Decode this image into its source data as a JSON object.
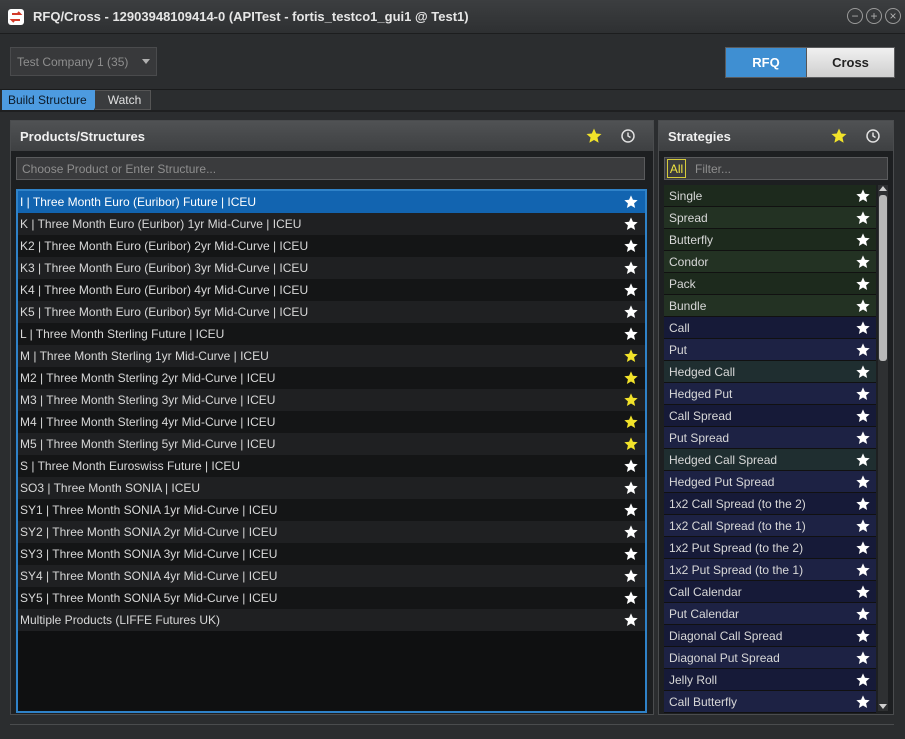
{
  "window": {
    "title": "RFQ/Cross - 12903948109414-0 (APITest - fortis_testco1_gui1 @ Test1)",
    "app_icon": "rfq-app-icon",
    "controls": [
      "minimize-icon",
      "maximize-icon",
      "close-icon"
    ]
  },
  "toolbar": {
    "company_selected": "Test Company 1 (35)",
    "rfq_label": "RFQ",
    "cross_label": "Cross",
    "active_mode": "RFQ"
  },
  "tabs": [
    {
      "label": "Build Structure",
      "active": true
    },
    {
      "label": "Watch",
      "active": false
    }
  ],
  "products_panel": {
    "title": "Products/Structures",
    "input_placeholder": "Choose Product or Enter Structure...",
    "items": [
      {
        "label": "I | Three Month Euro (Euribor) Future | ICEU",
        "favorite": false,
        "selected": true
      },
      {
        "label": "K | Three Month Euro (Euribor) 1yr Mid-Curve | ICEU",
        "favorite": false
      },
      {
        "label": "K2 | Three Month Euro (Euribor) 2yr Mid-Curve | ICEU",
        "favorite": false
      },
      {
        "label": "K3 | Three Month Euro (Euribor) 3yr Mid-Curve | ICEU",
        "favorite": false
      },
      {
        "label": "K4 | Three Month Euro (Euribor) 4yr Mid-Curve | ICEU",
        "favorite": false
      },
      {
        "label": "K5 | Three Month Euro (Euribor) 5yr Mid-Curve | ICEU",
        "favorite": false
      },
      {
        "label": "L | Three Month Sterling Future | ICEU",
        "favorite": false
      },
      {
        "label": "M | Three Month Sterling 1yr Mid-Curve | ICEU",
        "favorite": true
      },
      {
        "label": "M2 | Three Month Sterling 2yr Mid-Curve | ICEU",
        "favorite": true
      },
      {
        "label": "M3 | Three Month Sterling 3yr Mid-Curve | ICEU",
        "favorite": true
      },
      {
        "label": "M4 | Three Month Sterling 4yr Mid-Curve | ICEU",
        "favorite": true
      },
      {
        "label": "M5 | Three Month Sterling 5yr Mid-Curve | ICEU",
        "favorite": true
      },
      {
        "label": "S | Three Month Euroswiss Future | ICEU",
        "favorite": false
      },
      {
        "label": "SO3 | Three Month SONIA | ICEU",
        "favorite": false
      },
      {
        "label": "SY1 | Three Month SONIA 1yr Mid-Curve | ICEU",
        "favorite": false
      },
      {
        "label": "SY2 | Three Month SONIA 2yr Mid-Curve | ICEU",
        "favorite": false
      },
      {
        "label": "SY3 | Three Month SONIA 3yr Mid-Curve | ICEU",
        "favorite": false
      },
      {
        "label": "SY4 | Three Month SONIA 4yr Mid-Curve | ICEU",
        "favorite": false
      },
      {
        "label": "SY5 | Three Month SONIA 5yr Mid-Curve | ICEU",
        "favorite": false
      },
      {
        "label": "Multiple Products (LIFFE Futures UK)",
        "favorite": false
      }
    ]
  },
  "strategies_panel": {
    "title": "Strategies",
    "all_label": "All",
    "filter_placeholder": "Filter...",
    "items": [
      {
        "label": "Single",
        "group": "green"
      },
      {
        "label": "Spread",
        "group": "green"
      },
      {
        "label": "Butterfly",
        "group": "green"
      },
      {
        "label": "Condor",
        "group": "green"
      },
      {
        "label": "Pack",
        "group": "green"
      },
      {
        "label": "Bundle",
        "group": "green"
      },
      {
        "label": "Call",
        "group": "navy"
      },
      {
        "label": "Put",
        "group": "navy"
      },
      {
        "label": "Hedged Call",
        "group": "teal"
      },
      {
        "label": "Hedged Put",
        "group": "navy"
      },
      {
        "label": "Call Spread",
        "group": "navy"
      },
      {
        "label": "Put Spread",
        "group": "navy"
      },
      {
        "label": "Hedged Call Spread",
        "group": "teal"
      },
      {
        "label": "Hedged Put Spread",
        "group": "navy"
      },
      {
        "label": "1x2 Call Spread (to the 2)",
        "group": "navy"
      },
      {
        "label": "1x2 Call Spread (to the 1)",
        "group": "navy"
      },
      {
        "label": "1x2 Put Spread (to the 2)",
        "group": "navy"
      },
      {
        "label": "1x2 Put Spread (to the 1)",
        "group": "navy"
      },
      {
        "label": "Call Calendar",
        "group": "navy"
      },
      {
        "label": "Put Calendar",
        "group": "navy"
      },
      {
        "label": "Diagonal Call Spread",
        "group": "navy"
      },
      {
        "label": "Diagonal Put Spread",
        "group": "navy"
      },
      {
        "label": "Jelly Roll",
        "group": "navy"
      },
      {
        "label": "Call Butterfly",
        "group": "navy"
      }
    ]
  },
  "colors": {
    "accent_blue": "#3f8fd2",
    "selected_row": "#1264b0",
    "favorite_star": "#f2e32a",
    "star_default": "#ffffff"
  }
}
